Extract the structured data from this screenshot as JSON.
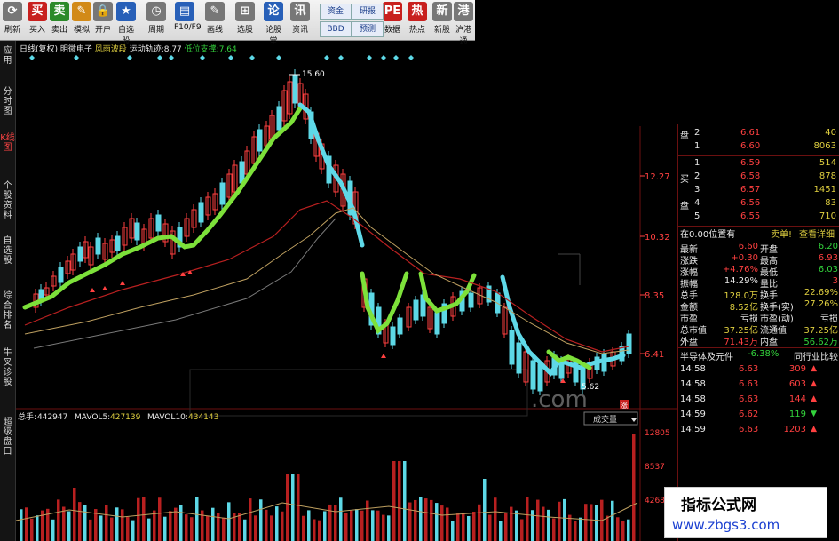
{
  "toolbar": {
    "items": [
      {
        "label": "刷新",
        "glyph": "⟳",
        "color": "gr"
      },
      {
        "label": "买入",
        "glyph": "买",
        "color": "r"
      },
      {
        "label": "卖出",
        "glyph": "卖",
        "color": "g"
      },
      {
        "label": "模拟",
        "glyph": "✎",
        "color": "o"
      },
      {
        "label": "开户",
        "glyph": "🔒",
        "color": "gr"
      },
      {
        "label": "自选股",
        "glyph": "★",
        "color": "b"
      },
      {
        "label": "周期",
        "glyph": "◷",
        "color": "gr"
      },
      {
        "label": "F10/F9",
        "glyph": "▤",
        "color": "b"
      },
      {
        "label": "画线",
        "glyph": "✎",
        "color": "gr"
      },
      {
        "label": "选股",
        "glyph": "⊞",
        "color": "gr"
      },
      {
        "label": "论股堂",
        "glyph": "论",
        "color": "b"
      },
      {
        "label": "资讯",
        "glyph": "讯",
        "color": "gr"
      },
      {
        "label": "数据",
        "glyph": "PE",
        "color": "r"
      },
      {
        "label": "热点",
        "glyph": "热",
        "color": "r"
      },
      {
        "label": "新股",
        "glyph": "新",
        "color": "gr"
      },
      {
        "label": "沪港通",
        "glyph": "港",
        "color": "gr"
      }
    ],
    "small_buttons": [
      "资金",
      "研报",
      "BBD",
      "预测"
    ]
  },
  "sidebar": {
    "tabs": [
      {
        "label": "应用",
        "active": false
      },
      {
        "label": "分时图",
        "active": false
      },
      {
        "label": "K线图",
        "active": true
      },
      {
        "label": "个股资料",
        "active": false
      },
      {
        "label": "自选股",
        "active": false
      },
      {
        "label": "综合排名",
        "active": false
      },
      {
        "label": "牛叉诊股",
        "active": false
      },
      {
        "label": "超级盘口",
        "active": false
      }
    ]
  },
  "chart": {
    "info": {
      "period": "日线(复权)",
      "stock": "明微电子",
      "indicator": "风雨波段",
      "track_label": "运动轨迹:",
      "track_value": "8.77",
      "support_label": "低位支撑:",
      "support_value": "7.64"
    },
    "high_label": "15.60",
    "low_label": "5.62",
    "price_ticks": [
      "12.27",
      "10.32",
      "8.35",
      "6.41"
    ],
    "volume_info": {
      "total_label": "总手:",
      "total_value": "442947",
      "ma5_label": "MAVOL5:",
      "ma5_value": "427139",
      "ma10_label": "MAVOL10:",
      "ma10_value": "434143"
    },
    "volume_ticks": [
      "12805",
      "8537",
      "4268"
    ],
    "volume_dropdown": "成交量",
    "badge": "涨"
  },
  "order_book": {
    "sell": [
      {
        "side": "盘",
        "level": "2",
        "price": "6.61",
        "vol": "40"
      },
      {
        "side": "",
        "level": "1",
        "price": "6.60",
        "vol": "8063"
      }
    ],
    "buy": [
      {
        "side": "",
        "level": "1",
        "price": "6.59",
        "vol": "514"
      },
      {
        "side": "买",
        "level": "2",
        "price": "6.58",
        "vol": "878"
      },
      {
        "side": "",
        "level": "3",
        "price": "6.57",
        "vol": "1451"
      },
      {
        "side": "盘",
        "level": "4",
        "price": "6.56",
        "vol": "83"
      },
      {
        "side": "",
        "level": "5",
        "price": "6.55",
        "vol": "710"
      }
    ],
    "notice": "在0.00位置有",
    "sell_link": "卖单!",
    "detail_link": "查看详细"
  },
  "quote": [
    {
      "l1": "最新",
      "v1": "6.60",
      "l2": "开盘",
      "v2": "6.20",
      "c1": "red",
      "c2": "grn"
    },
    {
      "l1": "涨跌",
      "v1": "+0.30",
      "l2": "最高",
      "v2": "6.93",
      "c1": "red",
      "c2": "red"
    },
    {
      "l1": "涨幅",
      "v1": "+4.76%",
      "l2": "最低",
      "v2": "6.03",
      "c1": "red",
      "c2": "grn"
    },
    {
      "l1": "振幅",
      "v1": "14.29%",
      "l2": "量比",
      "v2": "3",
      "c1": "wht",
      "c2": "red"
    },
    {
      "l1": "总手",
      "v1": "128.0万",
      "l2": "换手",
      "v2": "22.69%",
      "c1": "yel",
      "c2": "yel"
    },
    {
      "l1": "金额",
      "v1": "8.52亿",
      "l2": "换手(实)",
      "v2": "27.26%",
      "c1": "yel",
      "c2": "yel"
    },
    {
      "l1": "市盈",
      "v1": "亏损",
      "l2": "市盈(动)",
      "v2": "亏损",
      "c1": "wht",
      "c2": "wht"
    },
    {
      "l1": "总市值",
      "v1": "37.25亿",
      "l2": "流通值",
      "v2": "37.25亿",
      "c1": "yel",
      "c2": "yel"
    },
    {
      "l1": "外盘",
      "v1": "71.43万",
      "l2": "内盘",
      "v2": "56.62万",
      "c1": "red",
      "c2": "grn"
    }
  ],
  "sector": {
    "name": "半导体及元件",
    "change": "-6.38%",
    "compare": "同行业比较"
  },
  "ticks": [
    {
      "time": "14:58",
      "price": "6.63",
      "vol": "309",
      "dir": "up"
    },
    {
      "time": "14:58",
      "price": "6.63",
      "vol": "603",
      "dir": "up"
    },
    {
      "time": "14:58",
      "price": "6.63",
      "vol": "144",
      "dir": "up"
    },
    {
      "time": "14:59",
      "price": "6.62",
      "vol": "119",
      "dir": "down"
    },
    {
      "time": "14:59",
      "price": "6.63",
      "vol": "1203",
      "dir": "up"
    }
  ],
  "watermark": {
    "title": "指标公式网",
    "url": "www.zbgs3.com"
  },
  "dotcom_text": ".com",
  "colors": {
    "up": "#ff4040",
    "down": "#33d43c",
    "band_up": "#7de13a",
    "band_down": "#5fd9e8",
    "background": "#000000"
  }
}
